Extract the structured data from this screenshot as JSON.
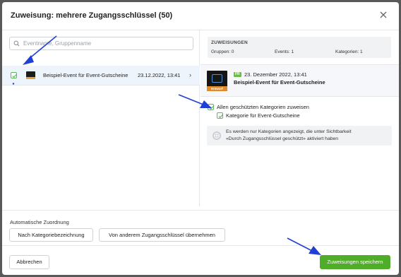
{
  "modal": {
    "title": "Zuweisung: mehrere Zugangsschlüssel (50)"
  },
  "search": {
    "placeholder": "Eventname, Gruppenname"
  },
  "event_row": {
    "title": "Beispiel-Event für Event-Gutscheine",
    "date": "23.12.2022, 13:41",
    "checked": true
  },
  "assignments": {
    "heading": "ZUWEISUNGEN",
    "groups_label": "Gruppen: 0",
    "events_label": "Events: 1",
    "categories_label": "Kategorien: 1"
  },
  "event_detail": {
    "language_tag": "FR",
    "date": "23. Dezember 2022, 13:41",
    "name": "Beispiel-Event für Event-Gutscheine",
    "image_banner": "Entwurf"
  },
  "categories": {
    "all_label": "Allen geschützten Kategorien zuweisen",
    "category_label": "Kategorie für Event-Gutscheine"
  },
  "info": {
    "line1": "Es werden nur Kategorien angezeigt, die unter Sichtbarkeit",
    "line2": "«Durch Zugangsschlüssel geschützt» aktiviert haben"
  },
  "auto_assign": {
    "label": "Automatische Zuordnung",
    "by_category_button": "Nach Kategoriebezeichnung",
    "from_other_key_button": "Von anderem Zugangsschlüssel übernehmen"
  },
  "footer": {
    "cancel_button": "Abbrechen",
    "save_button": "Zuweisungen speichern"
  },
  "colors": {
    "accent_green": "#4fad2a",
    "annotation_arrow": "#1f3fd6"
  },
  "icons": [
    "close-icon",
    "search-icon",
    "checkbox-checked-icon",
    "chevron-right-icon",
    "globe-icon"
  ]
}
